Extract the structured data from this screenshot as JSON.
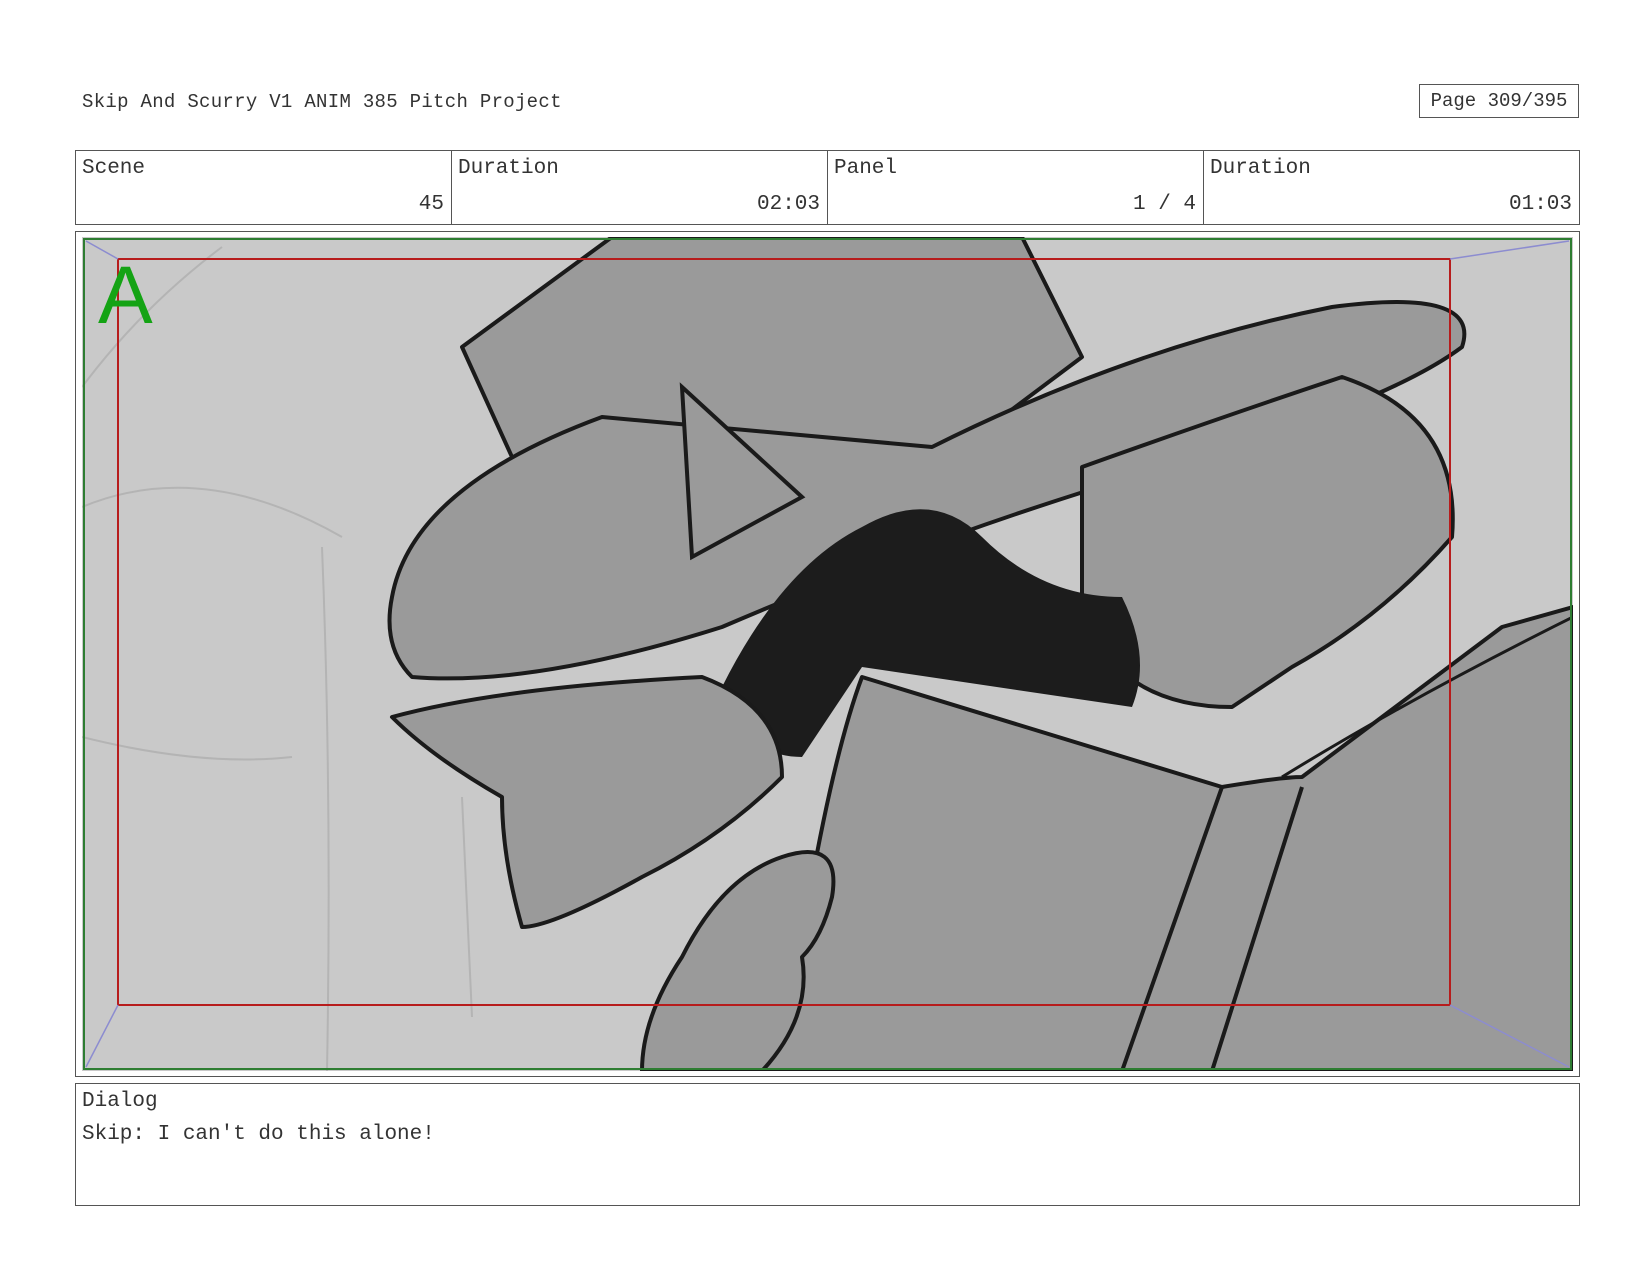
{
  "header": {
    "title": "Skip And Scurry V1  ANIM 385 Pitch Project",
    "page": "Page 309/395"
  },
  "info": {
    "scene_label": "Scene",
    "scene_value": "45",
    "scene_duration_label": "Duration",
    "scene_duration_value": "02:03",
    "panel_label": "Panel",
    "panel_value": "1 / 4",
    "panel_duration_label": "Duration",
    "panel_duration_value": "01:03"
  },
  "frame": {
    "panel_letter": "A",
    "safe_area_color": "#2e7d32",
    "action_area_color": "#b71c1c"
  },
  "dialog": {
    "label": "Dialog",
    "text": "Skip: I can't do this alone!"
  }
}
